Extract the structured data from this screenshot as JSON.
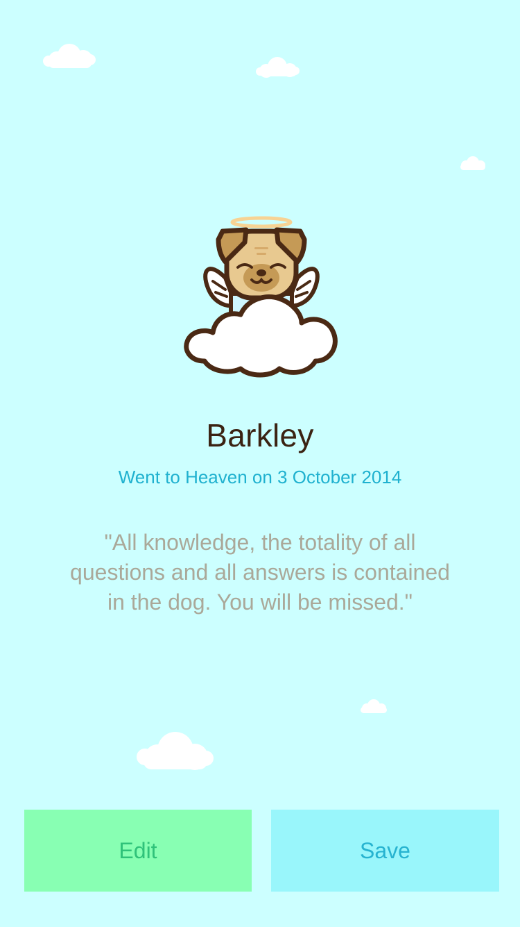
{
  "memorial": {
    "name": "Barkley",
    "date_text": "Went to Heaven on 3 October 2014",
    "quote": "\"All knowledge, the totality of all questions and all answers is contained in the dog. You will be missed.\""
  },
  "actions": {
    "edit_label": "Edit",
    "save_label": "Save"
  },
  "colors": {
    "background": "#ccffff",
    "edit_button": "#88ffb3",
    "save_button": "#99f6fb",
    "name_text": "#3b2313",
    "date_text": "#1fb1cf",
    "quote_text": "#aaa899"
  },
  "illustration": {
    "icon": "angel-dog-on-cloud-icon"
  }
}
